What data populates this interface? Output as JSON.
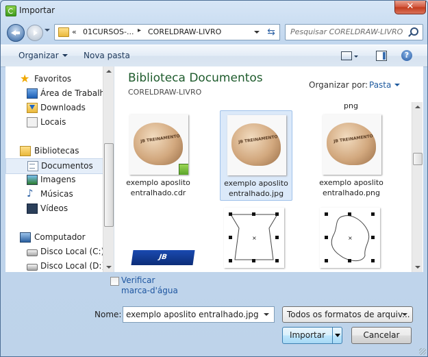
{
  "window": {
    "title": "Importar",
    "close_glyph": "✕"
  },
  "nav": {
    "path": [
      "«",
      "01CURSOS-...",
      "CORELDRAW-LIVRO"
    ],
    "search_placeholder": "Pesquisar CORELDRAW-LIVRO"
  },
  "toolbar": {
    "organize": "Organizar",
    "new_folder": "Nova pasta",
    "help_glyph": "?"
  },
  "sidebar": {
    "favorites": {
      "label": "Favoritos",
      "items": [
        "Área de Trabalho",
        "Downloads",
        "Locais"
      ]
    },
    "libraries": {
      "label": "Bibliotecas",
      "items": [
        "Documentos",
        "Imagens",
        "Músicas",
        "Vídeos"
      ],
      "selected": "Documentos"
    },
    "computer": {
      "label": "Computador",
      "items": [
        "Disco Local (C:)",
        "Disco Local (D:)"
      ]
    }
  },
  "content": {
    "title": "Biblioteca Documentos",
    "subtitle": "CORELDRAW-LIVRO",
    "arrange_label": "Organizar por:",
    "arrange_value": "Pasta",
    "partial_top": "png",
    "files": [
      {
        "line1": "exemplo aposlito",
        "line2": "entralhado.cdr",
        "type": "cdr"
      },
      {
        "line1": "exemplo aposlito",
        "line2": "entralhado.jpg",
        "type": "jpg",
        "selected": true
      },
      {
        "line1": "exemplo aposlito",
        "line2": "entralhado.png",
        "type": "png"
      }
    ],
    "thumb_text": "JB TREINAMENTO",
    "logo_text": "JB TREINAMENTO"
  },
  "bottom": {
    "watermark_line1": "Verificar",
    "watermark_line2": "marca-d'água",
    "name_label": "Nome:",
    "name_value": "exemplo aposlito entralhado.jpg",
    "type_value": "Todos os formatos de arquiv...",
    "import_button": "Importar",
    "cancel_button": "Cancelar"
  }
}
